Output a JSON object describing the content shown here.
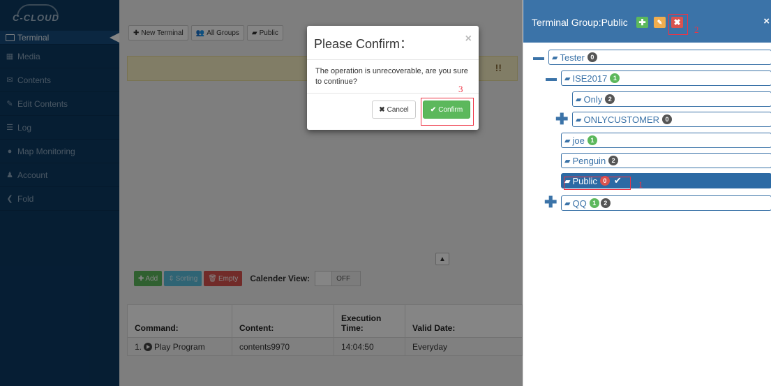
{
  "app": {
    "logo": "C-CLOUD"
  },
  "sidebar": {
    "items": [
      {
        "label": "Terminal",
        "icon": "monitor-icon"
      },
      {
        "label": "Media",
        "icon": "film-icon"
      },
      {
        "label": "Contents",
        "icon": "envelope-icon"
      },
      {
        "label": "Edit Contents",
        "icon": "edit-icon"
      },
      {
        "label": "Log",
        "icon": "list-icon"
      },
      {
        "label": "Map Monitoring",
        "icon": "globe-icon"
      },
      {
        "label": "Account",
        "icon": "user-icon"
      },
      {
        "label": "Fold",
        "icon": "chevron-left-icon"
      }
    ]
  },
  "toolbar": {
    "new_terminal": "New Terminal",
    "all_groups": "All Groups",
    "public": "Public"
  },
  "banner": {
    "tail": "!!"
  },
  "actions": {
    "add": "Add",
    "sorting": "Sorting",
    "empty": "Empty",
    "calendar_view": "Calender View:",
    "toggle": "OFF"
  },
  "table": {
    "headers": [
      "Command:",
      "Content:",
      "Execution Time:",
      "Valid Date:"
    ],
    "rows": [
      {
        "index": "1.",
        "command": "Play Program",
        "content": "contents9970",
        "time": "14:04:50",
        "valid": "Everyday"
      }
    ]
  },
  "modal": {
    "title": "Please Confirm：",
    "close": "×",
    "message": "The operation is unrecoverable, are you sure to continue?",
    "cancel": "Cancel",
    "confirm": "Confirm"
  },
  "panel": {
    "title": "Terminal Group:Public",
    "close": "×"
  },
  "tree": {
    "tester": {
      "label": "Tester",
      "badge": "0"
    },
    "ise2017": {
      "label": "ISE2017",
      "badge": "1"
    },
    "only": {
      "label": "Only",
      "badge": "2"
    },
    "onlycustomer": {
      "label": "ONLYCUSTOMER",
      "badge": "0"
    },
    "joe": {
      "label": "joe",
      "badge": "1"
    },
    "penguin": {
      "label": "Penguin",
      "badge": "2"
    },
    "public": {
      "label": "Public",
      "badge": "0"
    },
    "qq": {
      "label": "QQ",
      "badge1": "1",
      "badge2": "2"
    }
  },
  "annotations": {
    "n1": "1",
    "n2": "2",
    "n3": "3"
  },
  "colors": {
    "sidebar": "#0c3a63",
    "panel_header": "#3b73a8",
    "success": "#5cb85c",
    "danger": "#d9534f",
    "warning": "#f0ad4e",
    "annotation": "#e34"
  }
}
